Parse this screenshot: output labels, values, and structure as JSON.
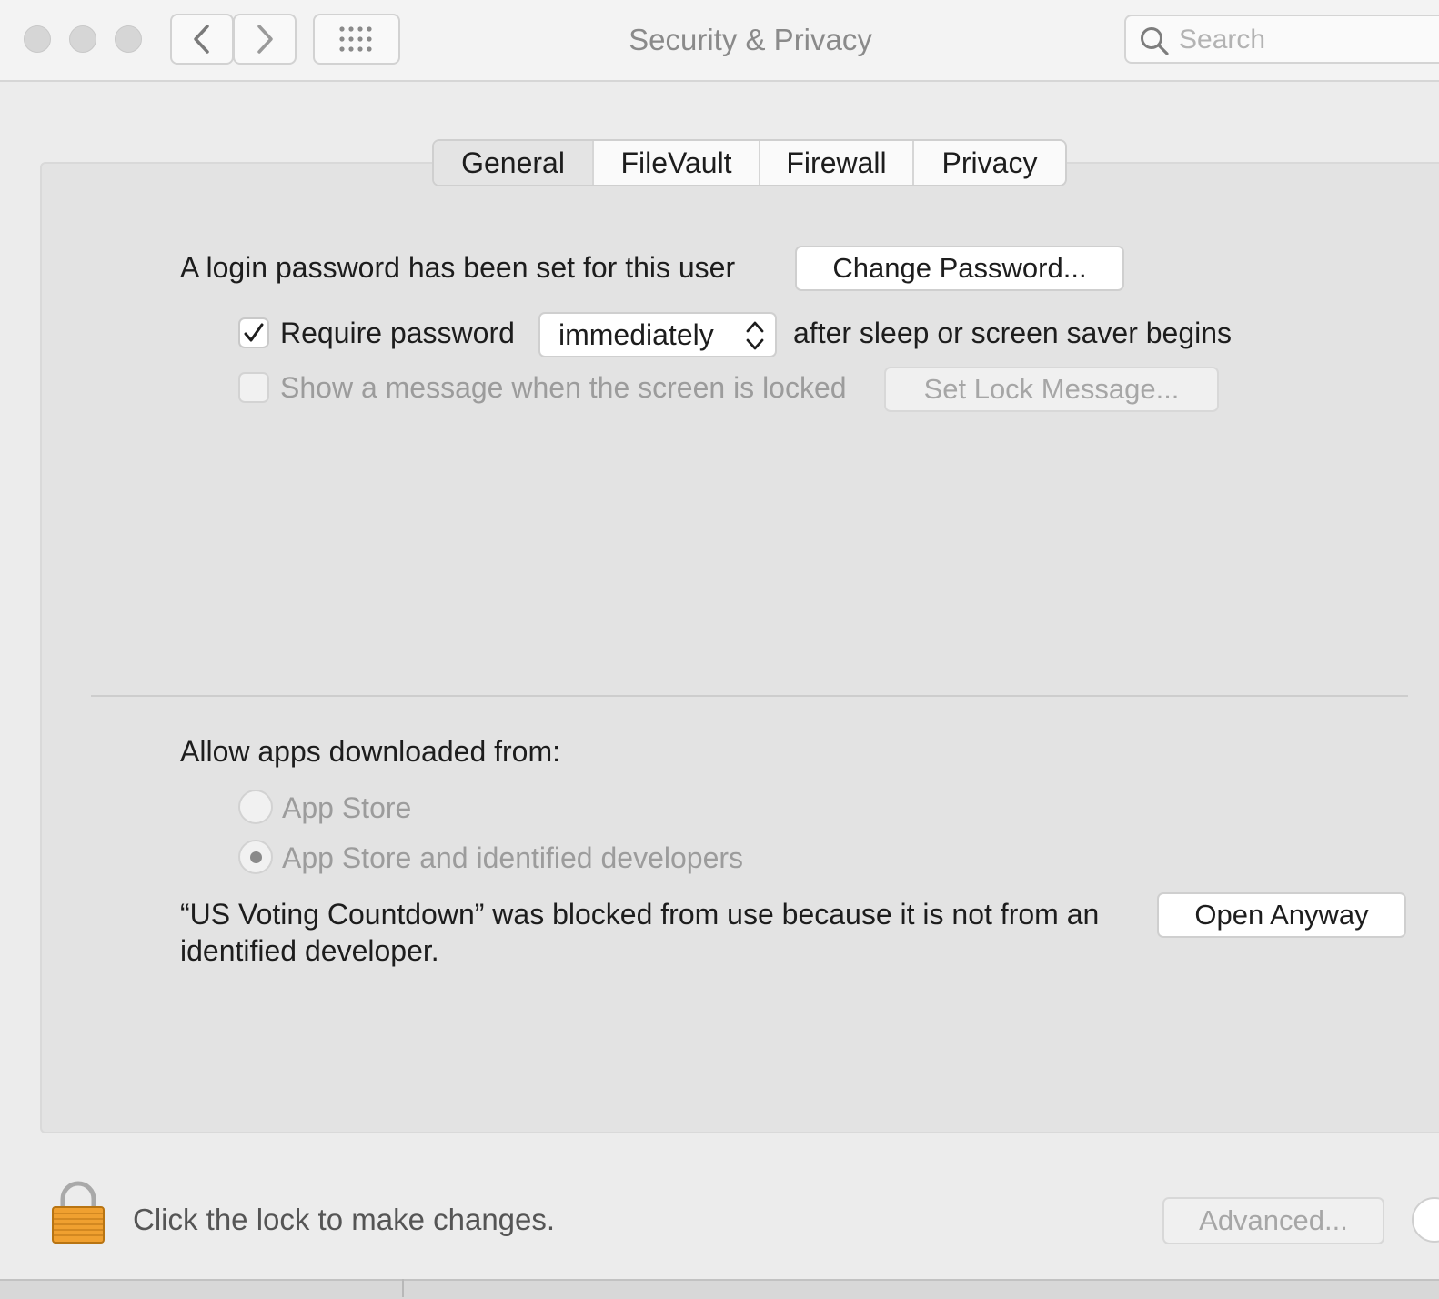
{
  "window": {
    "title": "Security & Privacy",
    "search_placeholder": "Search"
  },
  "tabs": [
    {
      "label": "General",
      "selected": true
    },
    {
      "label": "FileVault",
      "selected": false
    },
    {
      "label": "Firewall",
      "selected": false
    },
    {
      "label": "Privacy",
      "selected": false
    }
  ],
  "general": {
    "login_password_text": "A login password has been set for this user",
    "change_password_button": "Change Password...",
    "require_password": {
      "checked": true,
      "label": "Require password",
      "delay_value": "immediately",
      "suffix": "after sleep or screen saver begins"
    },
    "lock_message": {
      "checked": false,
      "enabled": false,
      "label": "Show a message when the screen is locked",
      "button": "Set Lock Message..."
    }
  },
  "gatekeeper": {
    "heading": "Allow apps downloaded from:",
    "options": [
      {
        "label": "App Store",
        "selected": false,
        "enabled": false
      },
      {
        "label": "App Store and identified developers",
        "selected": true,
        "enabled": false
      }
    ],
    "blocked_message": "“US Voting Countdown” was blocked from use because it is not from an identified developer.",
    "open_anyway_button": "Open Anyway"
  },
  "footer": {
    "lock_text": "Click the lock to make changes.",
    "advanced_button": "Advanced..."
  },
  "colors": {
    "window_bg": "#ececec",
    "panel_bg": "#e3e3e3",
    "disabled_text": "#9c9c9c",
    "lock_gold": "#f0a030"
  }
}
